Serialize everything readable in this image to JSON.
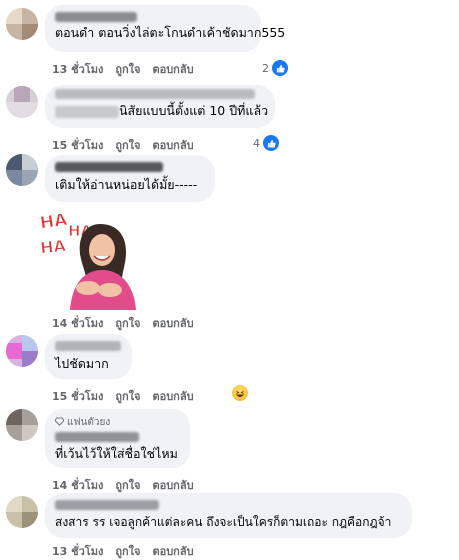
{
  "comments": [
    {
      "text": "ตอนดำ ตอนวิ่งไล่ตะโกนดำเค้าชัดมาก555",
      "time": "13 ชั่วโมง",
      "like": "ถูกใจ",
      "reply": "ตอบกลับ",
      "reaction_count": "2",
      "reaction_icon": "like-icon"
    },
    {
      "text": "นิสัยแบบนี้ตั้งแต่ 10 ปีที่แล้ว",
      "time": "15 ชั่วโมง",
      "like": "ถูกใจ",
      "reply": "ตอบกลับ",
      "reaction_count": "4",
      "reaction_icon": "like-icon"
    },
    {
      "text": "เติมให้อ่านหน่อยได้มั้ย-----",
      "time": "14 ชั่วโมง",
      "like": "ถูกใจ",
      "reply": "ตอบกลับ",
      "sticker_text": "HA HA HA"
    },
    {
      "text": "ไปชัดมาก",
      "time": "15 ชั่วโมง",
      "like": "ถูกใจ",
      "reply": "ตอบกลับ",
      "reaction_icon": "haha-icon"
    },
    {
      "badge": "แฟนตัวยง",
      "text": "ที่เว้นไว้ให้ใส่ชื่อใช่ไหม",
      "time": "14 ชั่วโมง",
      "like": "ถูกใจ",
      "reply": "ตอบกลับ"
    },
    {
      "text": "สงสาร รร เจอลูกค้าแต่ละคน ถึงจะเป็นใครก็ตามเถอะ กฎคือกฎจ้า",
      "time": "13 ชั่วโมง",
      "like": "ถูกใจ",
      "reply": "ตอบกลับ"
    }
  ],
  "colors": {
    "bubble": "#f0f2f5",
    "meta": "#65676b",
    "like_blue": "#1877f2"
  }
}
